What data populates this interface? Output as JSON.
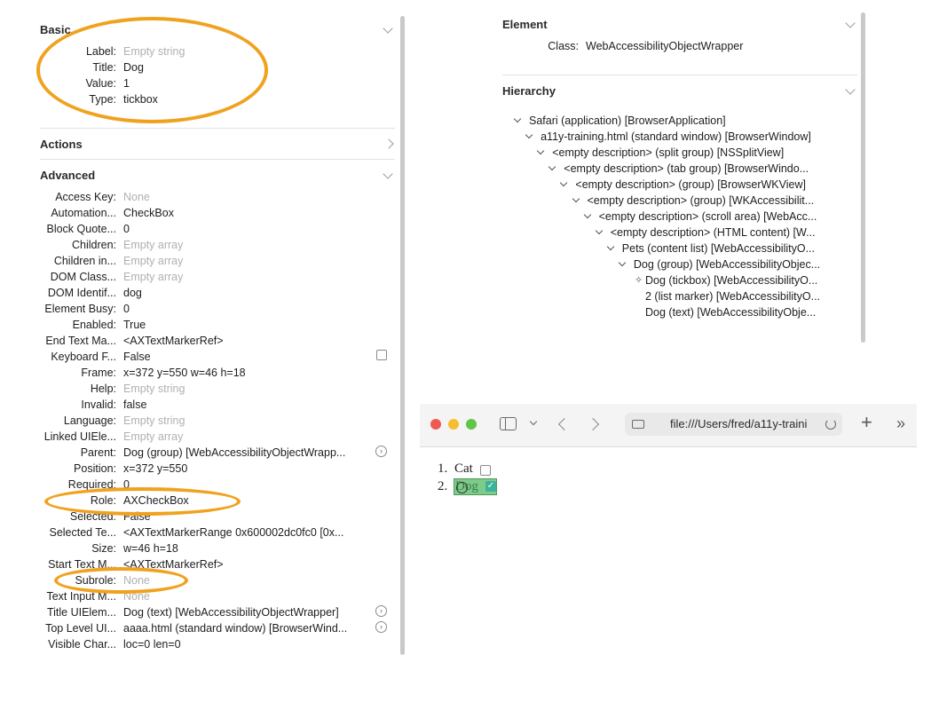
{
  "left_panel": {
    "basic": {
      "title": "Basic",
      "rows": [
        {
          "key": "Label:",
          "value": "Empty string",
          "placeholder": true
        },
        {
          "key": "Title:",
          "value": "Dog",
          "placeholder": false
        },
        {
          "key": "Value:",
          "value": "1",
          "placeholder": false
        },
        {
          "key": "Type:",
          "value": "tickbox",
          "placeholder": false
        }
      ]
    },
    "actions": {
      "title": "Actions"
    },
    "advanced": {
      "title": "Advanced",
      "rows": [
        {
          "key": "Access Key:",
          "value": "None",
          "placeholder": true
        },
        {
          "key": "Automation...",
          "value": "CheckBox",
          "placeholder": false
        },
        {
          "key": "Block Quote...",
          "value": "0",
          "placeholder": false
        },
        {
          "key": "Children:",
          "value": "Empty array",
          "placeholder": true
        },
        {
          "key": "Children in...",
          "value": "Empty array",
          "placeholder": true
        },
        {
          "key": "DOM Class...",
          "value": "Empty array",
          "placeholder": true
        },
        {
          "key": "DOM Identif...",
          "value": "dog",
          "placeholder": false
        },
        {
          "key": "Element Busy:",
          "value": "0",
          "placeholder": false
        },
        {
          "key": "Enabled:",
          "value": "True",
          "placeholder": false
        },
        {
          "key": "End Text Ma...",
          "value": "<AXTextMarkerRef>",
          "placeholder": false
        },
        {
          "key": "Keyboard F...",
          "value": "False",
          "placeholder": false
        },
        {
          "key": "Frame:",
          "value": "x=372 y=550 w=46 h=18",
          "placeholder": false
        },
        {
          "key": "Help:",
          "value": "Empty string",
          "placeholder": true
        },
        {
          "key": "Invalid:",
          "value": "false",
          "placeholder": false
        },
        {
          "key": "Language:",
          "value": "Empty string",
          "placeholder": true
        },
        {
          "key": "Linked UIEle...",
          "value": "Empty array",
          "placeholder": true
        },
        {
          "key": "Parent:",
          "value": "Dog (group) [WebAccessibilityObjectWrapp...",
          "placeholder": false
        },
        {
          "key": "Position:",
          "value": "x=372 y=550",
          "placeholder": false
        },
        {
          "key": "Required:",
          "value": "0",
          "placeholder": false
        },
        {
          "key": "Role:",
          "value": "AXCheckBox",
          "placeholder": false
        },
        {
          "key": "Selected:",
          "value": "False",
          "placeholder": false
        },
        {
          "key": "Selected Te...",
          "value": "<AXTextMarkerRange 0x600002dc0fc0 [0x...",
          "placeholder": false
        },
        {
          "key": "Size:",
          "value": "w=46 h=18",
          "placeholder": false
        },
        {
          "key": "Start Text M...",
          "value": "<AXTextMarkerRef>",
          "placeholder": false
        },
        {
          "key": "Subrole:",
          "value": "None",
          "placeholder": true
        },
        {
          "key": "Text Input M...",
          "value": "None",
          "placeholder": true
        },
        {
          "key": "Title UIElem...",
          "value": "Dog (text) [WebAccessibilityObjectWrapper]",
          "placeholder": false
        },
        {
          "key": "Top Level UI...",
          "value": "aaaa.html (standard window) [BrowserWind...",
          "placeholder": false
        },
        {
          "key": "Visible Char...",
          "value": "loc=0 len=0",
          "placeholder": false
        }
      ]
    }
  },
  "right_panel": {
    "element": {
      "title": "Element",
      "class_key": "Class:",
      "class_value": "WebAccessibilityObjectWrapper"
    },
    "hierarchy": {
      "title": "Hierarchy",
      "items": [
        {
          "label": "Safari (application) [BrowserApplication]",
          "depth": 0,
          "expanded": true
        },
        {
          "label": "a11y-training.html (standard window) [BrowserWindow]",
          "depth": 1,
          "expanded": true
        },
        {
          "label": "<empty description> (split group) [NSSplitView]",
          "depth": 2,
          "expanded": true
        },
        {
          "label": "<empty description> (tab group) [BrowserWindo...",
          "depth": 3,
          "expanded": true
        },
        {
          "label": "<empty description> (group) [BrowserWKView]",
          "depth": 4,
          "expanded": true
        },
        {
          "label": "<empty description> (group) [WKAccessibilit...",
          "depth": 5,
          "expanded": true
        },
        {
          "label": "<empty description> (scroll area) [WebAcc...",
          "depth": 6,
          "expanded": true
        },
        {
          "label": "<empty description> (HTML content) [W...",
          "depth": 7,
          "expanded": true
        },
        {
          "label": "Pets (content list) [WebAccessibilityO...",
          "depth": 8,
          "expanded": true
        },
        {
          "label": "Dog (group) [WebAccessibilityObjec...",
          "depth": 9,
          "expanded": true
        },
        {
          "label": "Dog (tickbox) [WebAccessibilityO...",
          "depth": 10,
          "expanded": false,
          "selected_marker": true
        },
        {
          "label": "2 (list marker) [WebAccessibilityO...",
          "depth": 10,
          "expanded": false
        },
        {
          "label": "Dog (text) [WebAccessibilityObje...",
          "depth": 10,
          "expanded": false
        }
      ]
    }
  },
  "browser": {
    "url": "file:///Users/fred/a11y-traini",
    "list": [
      {
        "marker": "1.",
        "label": "Cat",
        "checked": false
      },
      {
        "marker": "2.",
        "label": "Dog",
        "checked": true
      }
    ]
  },
  "colors": {
    "highlight_oval": "#f0a21f",
    "focus_green": "#7ccb8a",
    "checkbox_teal": "#3ab39a"
  }
}
